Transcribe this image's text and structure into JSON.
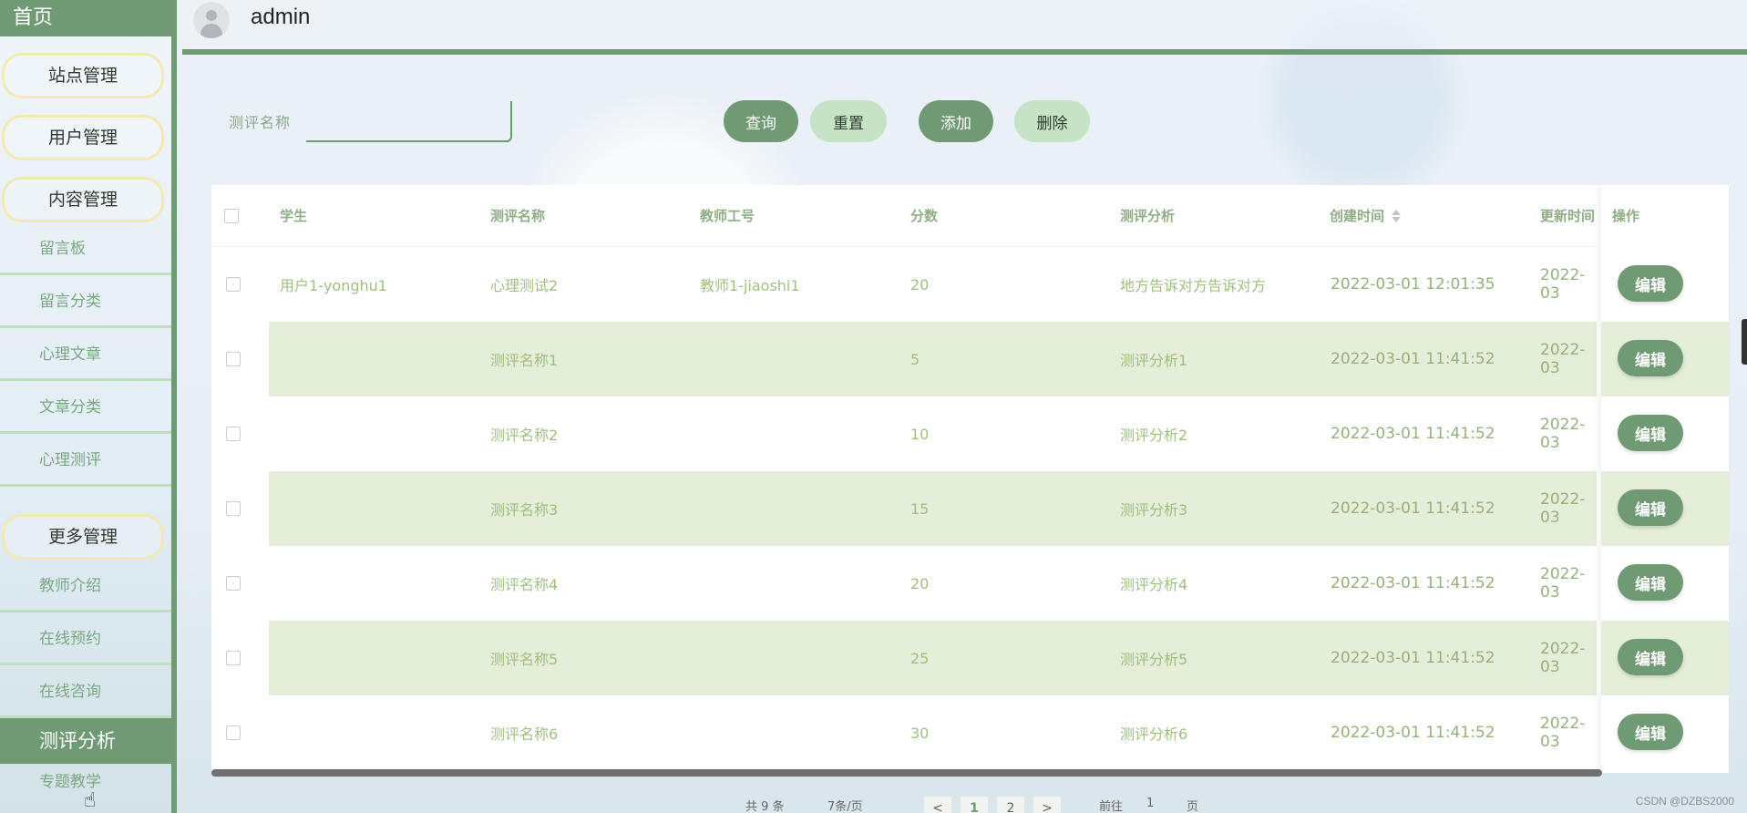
{
  "sidebar": {
    "home": "首页",
    "groups": [
      {
        "label": "站点管理"
      },
      {
        "label": "用户管理"
      },
      {
        "label": "内容管理"
      }
    ],
    "content_items": [
      "留言板",
      "留言分类",
      "心理文章",
      "文章分类",
      "心理测评"
    ],
    "more_group": "更多管理",
    "more_items": [
      "教师介绍",
      "在线预约",
      "在线咨询"
    ],
    "active_item": "测评分析",
    "last_item": "专题教学"
  },
  "header": {
    "username": "admin"
  },
  "search": {
    "label": "测评名称",
    "value": "",
    "buttons": {
      "query": "查询",
      "reset": "重置",
      "add": "添加",
      "delete": "删除"
    }
  },
  "table": {
    "columns": [
      "学生",
      "测评名称",
      "教师工号",
      "分数",
      "测评分析",
      "创建时间",
      "更新时间",
      "操作"
    ],
    "rows": [
      {
        "student": "用户1-yonghu1",
        "name": "心理测试2",
        "teacher": "教师1-jiaoshi1",
        "score": "20",
        "analysis": "地方告诉对方告诉对方",
        "created": "2022-03-01 12:01:35",
        "updated": "2022-03"
      },
      {
        "student": "",
        "name": "测评名称1",
        "teacher": "",
        "score": "5",
        "analysis": "测评分析1",
        "created": "2022-03-01 11:41:52",
        "updated": "2022-03"
      },
      {
        "student": "",
        "name": "测评名称2",
        "teacher": "",
        "score": "10",
        "analysis": "测评分析2",
        "created": "2022-03-01 11:41:52",
        "updated": "2022-03"
      },
      {
        "student": "",
        "name": "测评名称3",
        "teacher": "",
        "score": "15",
        "analysis": "测评分析3",
        "created": "2022-03-01 11:41:52",
        "updated": "2022-03"
      },
      {
        "student": "",
        "name": "测评名称4",
        "teacher": "",
        "score": "20",
        "analysis": "测评分析4",
        "created": "2022-03-01 11:41:52",
        "updated": "2022-03"
      },
      {
        "student": "",
        "name": "测评名称5",
        "teacher": "",
        "score": "25",
        "analysis": "测评分析5",
        "created": "2022-03-01 11:41:52",
        "updated": "2022-03"
      },
      {
        "student": "",
        "name": "测评名称6",
        "teacher": "",
        "score": "30",
        "analysis": "测评分析6",
        "created": "2022-03-01 11:41:52",
        "updated": "2022-03"
      }
    ],
    "edit_label": "编辑"
  },
  "pagination": {
    "total": "共 9 条",
    "per_page": "7条/页",
    "prev": "<",
    "page1": "1",
    "page2": "2",
    "next": ">",
    "goto": "前往",
    "goto_value": "1",
    "page_suffix": "页"
  },
  "watermark": "CSDN @DZBS2000",
  "colors": {
    "primary": "#6f9a73",
    "light": "#c6e3c5",
    "stripe": "#e4eed8"
  }
}
